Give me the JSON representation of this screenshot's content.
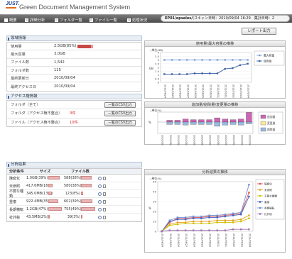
{
  "header": {
    "logo": "JUST.",
    "app_title": "Green Document Management System"
  },
  "nav": {
    "items": [
      "概要",
      "詳細分析",
      "フォルダ一覧",
      "ファイル一覧",
      "処理状況"
    ],
    "scan_info_bold": "EP01/epsales/",
    "scan_info_rest": "(スキャン日時：2010/09/04 16:29　集計日時：2"
  },
  "report_button": "レポート出力",
  "capacity": {
    "title": "領域情報",
    "rows": [
      {
        "label": "使用量",
        "value": "2.5GB(85%)"
      },
      {
        "label": "最大容量",
        "value": "3.0GB"
      },
      {
        "label": "ファイル数",
        "value": "1,542"
      },
      {
        "label": "フォルダ数",
        "value": "115"
      },
      {
        "label": "最終更新日",
        "value": "2010/09/04"
      },
      {
        "label": "最終アクセス日",
        "value": "2010/09/04"
      }
    ],
    "usage_fraction": 0.85
  },
  "access": {
    "title": "アクセス権情報",
    "rows": [
      {
        "label": "フォルダ（全て）",
        "count": "",
        "button": "一覧のCSV出力"
      },
      {
        "label": "フォルダ（アクセス権不整合）",
        "count": "3件",
        "button": "一覧のCSV出力"
      },
      {
        "label": "ファイル（アクセス権不整合）",
        "count": "10件",
        "button": "一覧のCSV出力"
      }
    ]
  },
  "analysis": {
    "title": "分析結果",
    "headers": [
      "分析条件",
      "サイズ",
      "ファイル数"
    ],
    "rows": [
      {
        "cond": "陳腐化",
        "size": "1.0GB(39%)",
        "size_pct": 0.39,
        "files": "588(38%)",
        "files_pct": 0.38
      },
      {
        "cond": "未参照",
        "size": "417.6MB(16%)",
        "size_pct": 0.16,
        "files": "580(38%)",
        "files_pct": 0.38
      },
      {
        "cond": "不要な種類",
        "size": "345.0MB(13%)",
        "size_pct": 0.13,
        "files": "123(8%)",
        "files_pct": 0.08
      },
      {
        "cond": "重複",
        "size": "922.4MB(35%)",
        "size_pct": 0.35,
        "files": "602(39%)",
        "files_pct": 0.39
      },
      {
        "cond": "長期横転",
        "size": "1.2GB(47%)",
        "size_pct": 0.47,
        "files": "755(49%)",
        "files_pct": 0.49
      },
      {
        "cond": "社外秘",
        "size": "43.5MB(2%)",
        "size_pct": 0.02,
        "files": "39(3%)",
        "files_pct": 0.03
      }
    ]
  },
  "chart_data": [
    {
      "type": "line",
      "title": "使用量/最大容量の推移",
      "ylabel": "GB",
      "unit": "(単位:GB)",
      "ylim": [
        0,
        4
      ],
      "yticks": [
        "0",
        "0.5",
        "1",
        "1.5",
        "2",
        "2.5",
        "3",
        "3.5",
        "4"
      ],
      "categories": [
        "2010/08/24",
        "2010/08/25",
        "2010/08/26",
        "2010/08/27",
        "2010/08/28",
        "2010/08/29",
        "2010/08/30",
        "2010/08/31",
        "2010/09/01",
        "2010/09/02",
        "2010/09/03",
        "2010/09/04"
      ],
      "series": [
        {
          "name": "最大容量",
          "values": [
            3,
            3,
            3,
            3,
            3,
            3,
            3,
            3,
            3,
            3,
            3,
            3
          ],
          "color": "#7aa0d8"
        },
        {
          "name": "使用量",
          "values": [
            1.1,
            1.1,
            1.1,
            1.1,
            1.2,
            1.2,
            1.2,
            1.2,
            1.8,
            1.9,
            2.3,
            2.5
          ],
          "color": "#3a5fa8"
        }
      ]
    },
    {
      "type": "bar",
      "title": "追加量/削除量/変更量の推移",
      "unit": "(単位:%)",
      "ylabel": "%",
      "categories": [
        "2010/08/24",
        "2010/08/25",
        "2010/08/26",
        "2010/08/27",
        "2010/08/28",
        "2010/08/29",
        "2010/08/30",
        "2010/08/31",
        "2010/09/01",
        "2010/09/02",
        "2010/09/03",
        "2010/09/04"
      ],
      "series": [
        {
          "name": "追加量",
          "values": [
            0,
            3,
            3,
            5,
            4,
            4,
            4,
            7,
            5,
            4,
            5,
            16
          ],
          "color": "#cc66b3"
        },
        {
          "name": "変更量",
          "values": [
            0,
            0,
            0,
            0,
            0,
            0,
            0,
            0,
            0,
            0,
            0,
            0
          ],
          "color": "#ffe89a"
        },
        {
          "name": "削除量",
          "values": [
            0,
            -4,
            -4,
            -5,
            -4,
            -4,
            -4,
            -7,
            -5,
            -4,
            -5,
            -3
          ],
          "color": "#9ab8e0"
        }
      ]
    },
    {
      "type": "line",
      "title": "分析結果の推移",
      "unit": "(単位:%)",
      "ylabel": "%",
      "ylim": [
        0,
        50
      ],
      "yticks": [
        "0",
        "10",
        "20",
        "30",
        "40",
        "50"
      ],
      "categories": [
        "2010/08/24",
        "2010/08/25",
        "2010/08/26",
        "2010/08/27",
        "2010/08/28",
        "2010/08/29",
        "2010/08/30",
        "2010/08/31",
        "2010/09/01",
        "2010/09/02",
        "2010/09/03",
        "2010/09/04"
      ],
      "series": [
        {
          "name": "陳腐化",
          "values": [
            0,
            9,
            13,
            13,
            14,
            14,
            15,
            15,
            16,
            17,
            18,
            39
          ],
          "color": "#e05050"
        },
        {
          "name": "未参照",
          "values": [
            0,
            7,
            9,
            9,
            10,
            10,
            10,
            11,
            11,
            11,
            12,
            16
          ],
          "color": "#e8a020"
        },
        {
          "name": "不要な種類",
          "values": [
            0,
            6,
            7,
            8,
            8,
            8,
            8,
            9,
            9,
            9,
            10,
            13
          ],
          "color": "#d0c000"
        },
        {
          "name": "重複",
          "values": [
            0,
            10,
            12,
            12,
            13,
            13,
            14,
            14,
            15,
            16,
            17,
            35
          ],
          "color": "#4060c0"
        },
        {
          "name": "長期横転",
          "values": [
            0,
            11,
            14,
            14,
            15,
            15,
            16,
            16,
            17,
            18,
            19,
            47
          ],
          "color": "#7090d0"
        },
        {
          "name": "社外秘",
          "values": [
            0,
            1,
            1,
            1,
            1,
            1,
            1,
            1,
            1,
            2,
            2,
            2
          ],
          "color": "#a070b0"
        }
      ]
    }
  ]
}
